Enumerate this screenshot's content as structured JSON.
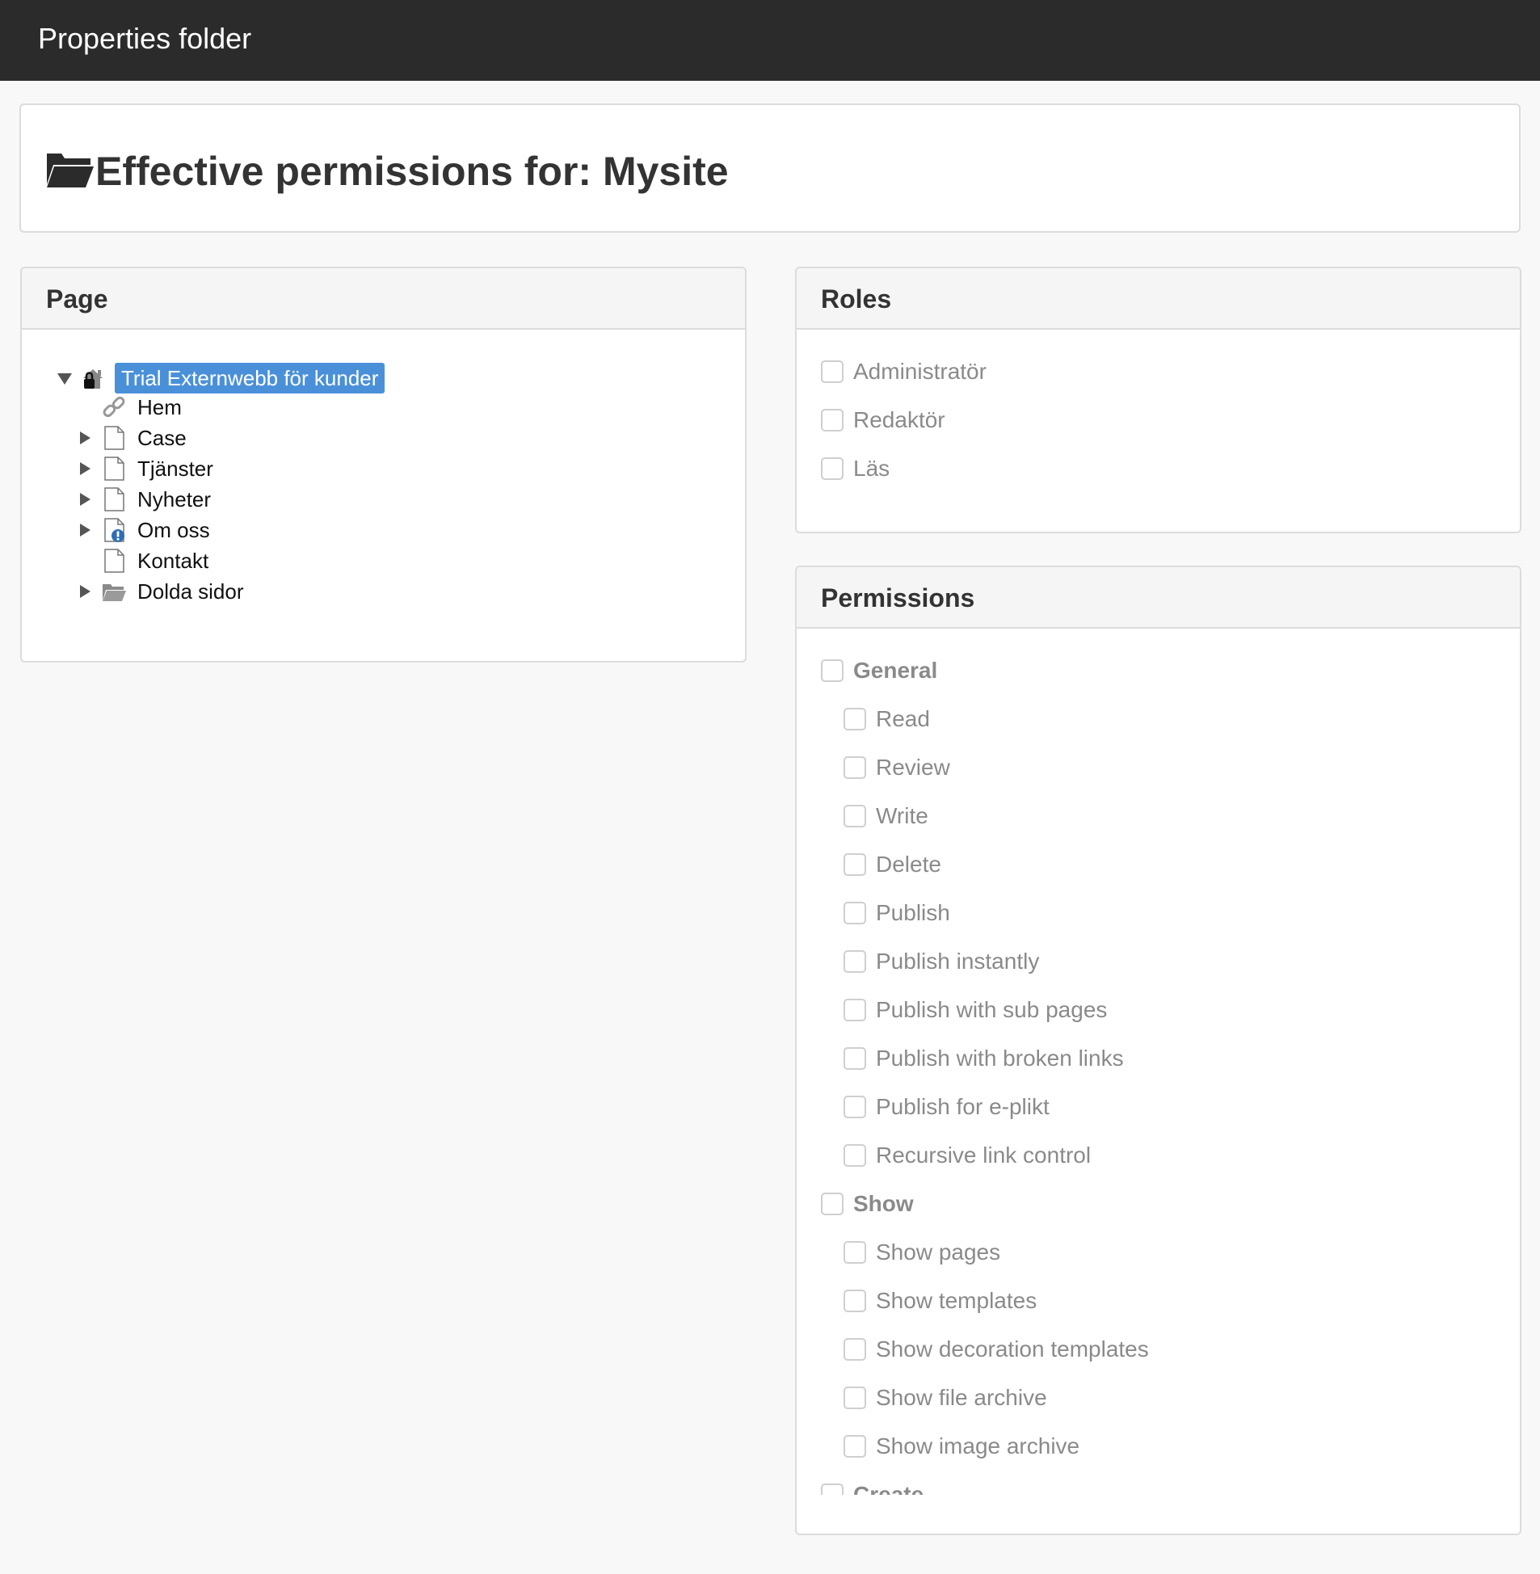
{
  "topbar": {
    "title": "Properties folder"
  },
  "header": {
    "icon": "folder-open-icon",
    "title_prefix": "Effective permissions for: ",
    "site_name": "Mysite"
  },
  "page_panel": {
    "title": "Page",
    "tree": {
      "root": {
        "label": "Trial Externwebb för kunder",
        "icon": "locked-home-icon",
        "expanded": true,
        "selected": true
      },
      "children": [
        {
          "label": "Hem",
          "icon": "link-icon",
          "has_children": false
        },
        {
          "label": "Case",
          "icon": "page-icon",
          "has_children": true
        },
        {
          "label": "Tjänster",
          "icon": "page-icon",
          "has_children": true
        },
        {
          "label": "Nyheter",
          "icon": "page-icon",
          "has_children": true
        },
        {
          "label": "Om oss",
          "icon": "page-warning-icon",
          "has_children": true
        },
        {
          "label": "Kontakt",
          "icon": "page-icon",
          "has_children": false
        },
        {
          "label": "Dolda sidor",
          "icon": "folder-icon",
          "has_children": true
        }
      ]
    }
  },
  "roles_panel": {
    "title": "Roles",
    "roles": [
      {
        "label": "Administratör",
        "checked": false
      },
      {
        "label": "Redaktör",
        "checked": false
      },
      {
        "label": "Läs",
        "checked": false
      }
    ]
  },
  "permissions_panel": {
    "title": "Permissions",
    "items": [
      {
        "label": "General",
        "group": true
      },
      {
        "label": "Read",
        "group": false
      },
      {
        "label": "Review",
        "group": false
      },
      {
        "label": "Write",
        "group": false
      },
      {
        "label": "Delete",
        "group": false
      },
      {
        "label": "Publish",
        "group": false
      },
      {
        "label": "Publish instantly",
        "group": false
      },
      {
        "label": "Publish with sub pages",
        "group": false
      },
      {
        "label": "Publish with broken links",
        "group": false
      },
      {
        "label": "Publish for e-plikt",
        "group": false
      },
      {
        "label": "Recursive link control",
        "group": false
      },
      {
        "label": "Show",
        "group": true
      },
      {
        "label": "Show pages",
        "group": false
      },
      {
        "label": "Show templates",
        "group": false
      },
      {
        "label": "Show decoration templates",
        "group": false
      },
      {
        "label": "Show file archive",
        "group": false
      },
      {
        "label": "Show image archive",
        "group": false
      },
      {
        "label": "Create",
        "group": true
      }
    ]
  }
}
